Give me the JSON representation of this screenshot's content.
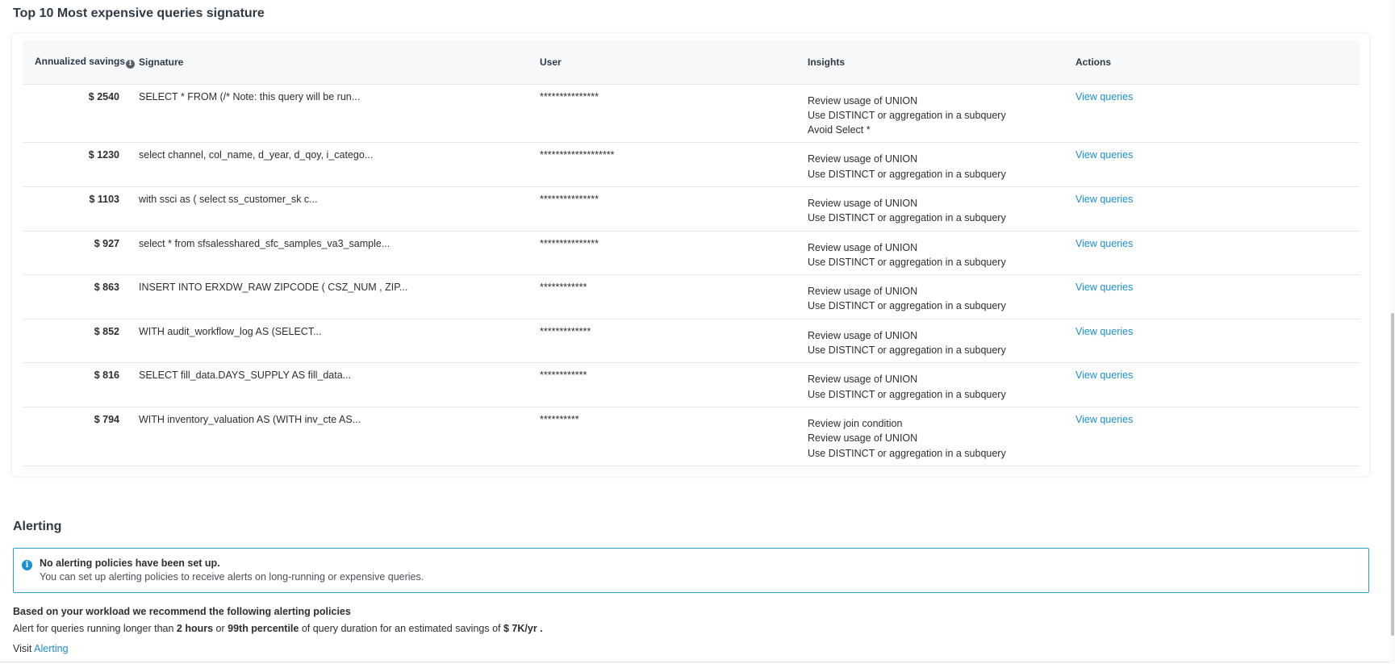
{
  "page": {
    "title": "Top 10 Most expensive queries signature"
  },
  "table": {
    "headers": {
      "savings": "Annualized savings",
      "signature": "Signature",
      "user": "User",
      "insights": "Insights",
      "actions": "Actions"
    },
    "info_icon": "info-icon",
    "rows": [
      {
        "savings": "$ 2540",
        "signature": "SELECT * FROM (/* Note: this query will be run...",
        "user": "***************",
        "insights": [
          "Review usage of UNION",
          "Use DISTINCT or aggregation in a subquery",
          "Avoid Select *"
        ],
        "action": "View queries"
      },
      {
        "savings": "$ 1230",
        "signature": "select channel, col_name, d_year, d_qoy, i_catego...",
        "user": "*******************",
        "insights": [
          "Review usage of UNION",
          "Use DISTINCT or aggregation in a subquery"
        ],
        "action": "View queries"
      },
      {
        "savings": "$ 1103",
        "signature": "with ssci as ( select ss_customer_sk c...",
        "user": "***************",
        "insights": [
          "Review usage of UNION",
          "Use DISTINCT or aggregation in a subquery"
        ],
        "action": "View queries"
      },
      {
        "savings": "$ 927",
        "signature": "select * from sfsalesshared_sfc_samples_va3_sample...",
        "user": "***************",
        "insights": [
          "Review usage of UNION",
          "Use DISTINCT or aggregation in a subquery"
        ],
        "action": "View queries"
      },
      {
        "savings": "$ 863",
        "signature": "INSERT INTO ERXDW_RAW ZIPCODE ( CSZ_NUM , ZIP...",
        "user": "************",
        "insights": [
          "Review usage of UNION",
          "Use DISTINCT or aggregation in a subquery"
        ],
        "action": "View queries"
      },
      {
        "savings": "$ 852",
        "signature": "WITH audit_workflow_log AS (SELECT...",
        "user": "*************",
        "insights": [
          "Review usage of UNION",
          "Use DISTINCT or aggregation in a subquery"
        ],
        "action": "View queries"
      },
      {
        "savings": "$ 816",
        "signature": "SELECT fill_data.DAYS_SUPPLY AS fill_data...",
        "user": "************",
        "insights": [
          "Review usage of UNION",
          "Use DISTINCT or aggregation in a subquery"
        ],
        "action": "View queries"
      },
      {
        "savings": "$ 794",
        "signature": "WITH inventory_valuation AS (WITH inv_cte AS...",
        "user": "**********",
        "insights": [
          "Review join condition",
          "Review usage of UNION",
          "Use DISTINCT or aggregation in a subquery"
        ],
        "action": "View queries"
      }
    ]
  },
  "alerting": {
    "title": "Alerting",
    "notice_icon": "info-icon",
    "notice_title": "No alerting policies have been set up.",
    "notice_text": "You can set up alerting policies to receive alerts on long-running or expensive queries.",
    "recommend_title": "Based on your workload we recommend the following alerting policies",
    "recommend_prefix": "Alert for queries running longer than ",
    "recommend_hours": "2 hours",
    "recommend_or": " or ",
    "recommend_percentile": "99th percentile",
    "recommend_middle": " of query duration for an estimated savings of ",
    "recommend_savings": "$ 7K/yr .",
    "visit_label": "Visit ",
    "visit_link": "Alerting"
  },
  "colors": {
    "link": "#1a8fd1",
    "alert_border": "#2a9fd1",
    "header_bg": "#f7f8fa"
  }
}
